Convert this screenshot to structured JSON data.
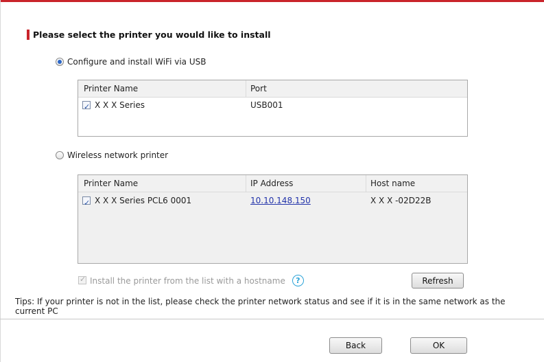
{
  "heading": "Please select the printer you would like to install",
  "usb_option": {
    "label": "Configure and install WiFi via USB",
    "selected": true,
    "columns": [
      "Printer Name",
      "Port"
    ],
    "rows": [
      {
        "checked": true,
        "name": "X X X Series",
        "port": "USB001"
      }
    ]
  },
  "wireless_option": {
    "label": "Wireless network printer",
    "selected": false,
    "columns": [
      "Printer Name",
      "IP Address",
      "Host name"
    ],
    "rows": [
      {
        "checked": true,
        "name": "X X X Series PCL6 0001",
        "ip": "10.10.148.150",
        "host": "X X X -02D22B"
      }
    ]
  },
  "hostname_option": {
    "label": "Install the printer from the list with a hostname",
    "checked": true,
    "enabled": false
  },
  "help_glyph": "?",
  "refresh_label": "Refresh",
  "tips": "Tips: If your printer is not in the list, please check the printer network status and see if it is in the same network as the current PC",
  "buttons": {
    "back": "Back",
    "ok": "OK"
  },
  "icons": {
    "help": "help-icon",
    "check": "checkmark-icon"
  },
  "colors": {
    "accent": "#c9242b",
    "radio_selected": "#2b67c8",
    "link": "#2233aa",
    "help": "#2ba3d8"
  }
}
